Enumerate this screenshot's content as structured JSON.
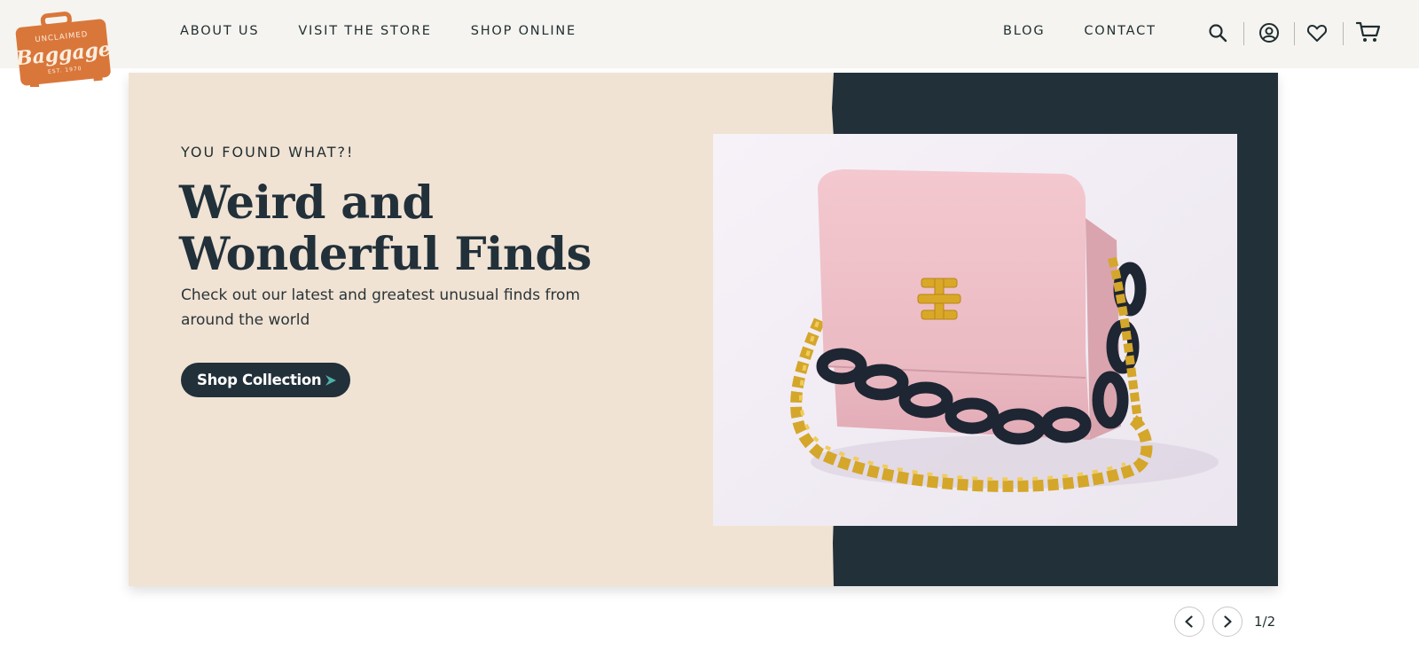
{
  "brand": {
    "logo_lines": [
      "UNCLAIMED",
      "Baggage",
      "EST. 1970"
    ],
    "logo_color": "#d9773a"
  },
  "nav": {
    "left": [
      {
        "label": "ABOUT US"
      },
      {
        "label": "VISIT THE STORE"
      },
      {
        "label": "SHOP ONLINE"
      }
    ],
    "right": [
      {
        "label": "BLOG"
      },
      {
        "label": "CONTACT"
      }
    ],
    "icons": [
      "search-icon",
      "account-icon",
      "wishlist-icon",
      "cart-icon"
    ]
  },
  "hero": {
    "eyebrow": "YOU FOUND WHAT?!",
    "headline": "Weird and Wonderful Finds",
    "subtext": "Check out our latest and greatest unusual finds from around the world",
    "cta_label": "Shop Collection",
    "background_color": "#f0e3d4",
    "accent_panel_color": "#22303a",
    "image_subject": "pink-handbag-with-chain-strap"
  },
  "pager": {
    "current": 1,
    "total": 2,
    "label": "1/2"
  }
}
